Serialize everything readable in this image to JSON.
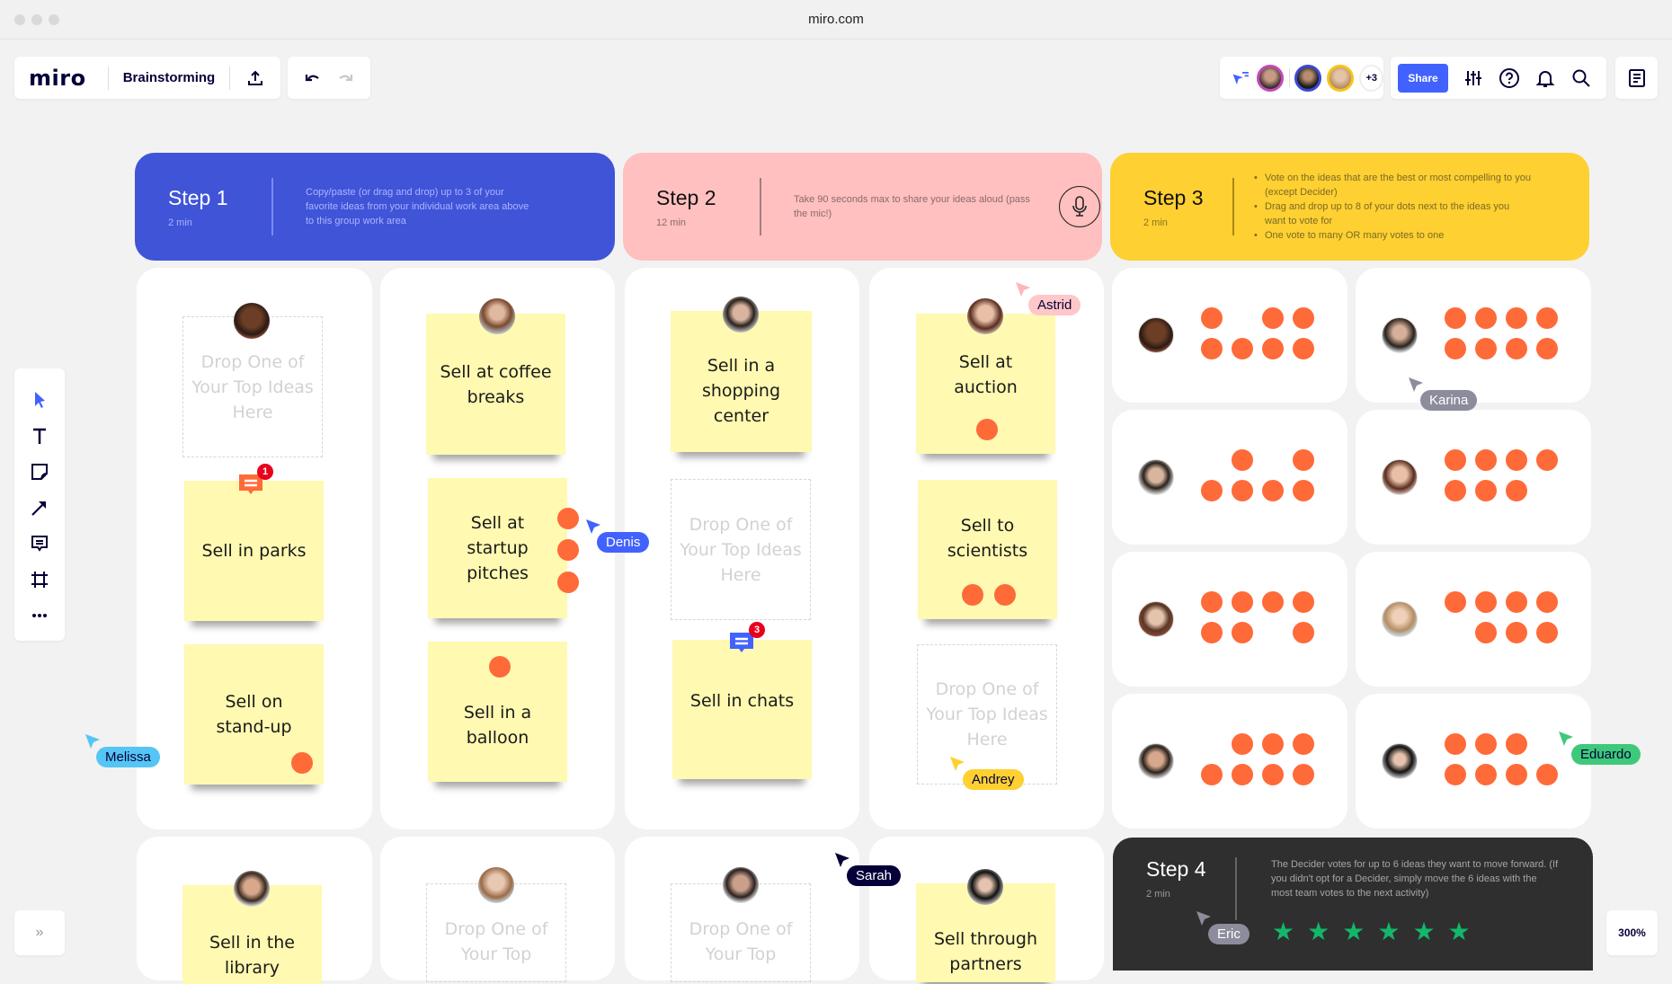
{
  "browser": {
    "url": "miro.com"
  },
  "header": {
    "logo": "miro",
    "board_name": "Brainstorming",
    "share_label": "Share",
    "collaborators_extra": "+3",
    "zoom_level": "300%"
  },
  "steps": [
    {
      "title": "Step 1",
      "duration": "2 min",
      "description": "Copy/paste (or drag and drop) up to 3 of your favorite ideas from your individual work area above to this group work area"
    },
    {
      "title": "Step 2",
      "duration": "12 min",
      "description": "Take 90 seconds max to share your ideas aloud (pass the mic!)"
    },
    {
      "title": "Step 3",
      "duration": "2 min",
      "bullets": [
        "Vote on the ideas that are the best or most compelling to you (except Decider)",
        "Drag and drop up to 8 of your dots next to the ideas you want to vote for",
        "One vote to many OR many votes to one"
      ]
    },
    {
      "title": "Step 4",
      "duration": "2 min",
      "description": "The Decider votes for up to 6 ideas they want to move forward. (If you didn't opt for a Decider, simply move the 6 ideas with the most team votes to the next activity)",
      "stars": 6
    }
  ],
  "placeholder_text": "Drop One of Your Top Ideas Here",
  "placeholder_text_partial": "Drop One of Your Top",
  "stickies": {
    "coffee": "Sell at coffee breaks",
    "shopping": "Sell in a shopping center",
    "auction": "Sell at auction",
    "parks": "Sell in parks",
    "startup": "Sell at startup pitches",
    "scientists": "Sell to scientists",
    "standup": "Sell on stand-up",
    "balloon": "Sell in a balloon",
    "chats": "Sell in chats",
    "library": "Sell in the library",
    "partners": "Sell through partners"
  },
  "comments": {
    "parks_count": "1",
    "chats_count": "3"
  },
  "votes": {
    "auction": 1,
    "startup": 3,
    "scientists": 2,
    "standup": 1,
    "balloon": 1
  },
  "dot_grids": [
    {
      "person": "voter-1",
      "dots": [
        1,
        0,
        1,
        1,
        1,
        1,
        1,
        1
      ]
    },
    {
      "person": "voter-2",
      "dots": [
        1,
        1,
        1,
        1,
        1,
        1,
        1,
        1
      ]
    },
    {
      "person": "voter-3",
      "dots": [
        0,
        1,
        0,
        1,
        1,
        1,
        1,
        1
      ]
    },
    {
      "person": "voter-4",
      "dots": [
        1,
        1,
        1,
        1,
        1,
        1,
        1,
        0
      ]
    },
    {
      "person": "voter-5",
      "dots": [
        1,
        1,
        1,
        1,
        1,
        1,
        0,
        1
      ]
    },
    {
      "person": "voter-6",
      "dots": [
        1,
        1,
        1,
        1,
        0,
        1,
        1,
        1
      ]
    },
    {
      "person": "voter-7",
      "dots": [
        0,
        1,
        1,
        1,
        1,
        1,
        1,
        1
      ]
    },
    {
      "person": "voter-8",
      "dots": [
        1,
        1,
        1,
        0,
        1,
        1,
        1,
        1
      ]
    }
  ],
  "cursors": {
    "astrid": "Astrid",
    "karina": "Karina",
    "denis": "Denis",
    "melissa": "Melissa",
    "andrey": "Andrey",
    "eduardo": "Eduardo",
    "sarah": "Sarah",
    "eric": "Eric"
  },
  "colors": {
    "accent": "#4262ff",
    "step1": "#4054d8",
    "step2": "#ffc0bf",
    "step3": "#fed031",
    "step4": "#2f2f2f",
    "sticky": "#fff9b1",
    "vote_dot": "#ff6a39",
    "star": "#12b76a"
  }
}
